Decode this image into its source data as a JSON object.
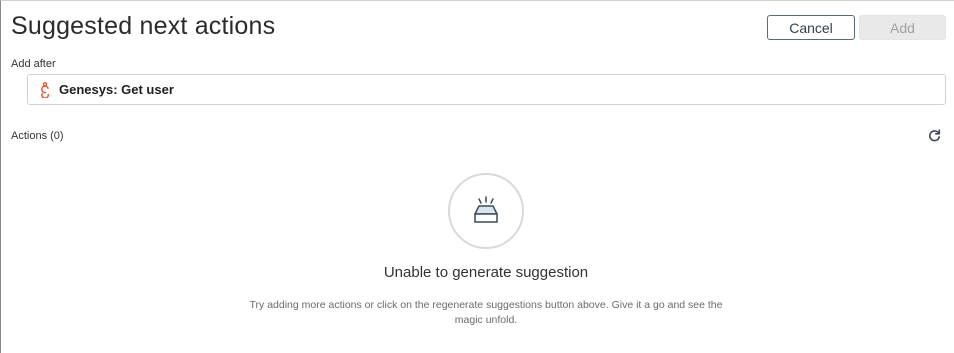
{
  "header": {
    "title": "Suggested next actions",
    "cancel_label": "Cancel",
    "add_label": "Add"
  },
  "add_after": {
    "label": "Add after",
    "value": "Genesys: Get user",
    "icon": "genesys-logo-icon"
  },
  "actions": {
    "label": "Actions (0)",
    "refresh_icon": "refresh-icon"
  },
  "empty_state": {
    "icon": "empty-tray-icon",
    "title": "Unable to generate suggestion",
    "description": "Try adding more actions or click on the regenerate suggestions button above. Give it a go and see the magic unfold."
  },
  "colors": {
    "brand_icon": "#e8552f",
    "primary_border": "#5b6a78",
    "disabled_bg": "#e9e9e9"
  }
}
